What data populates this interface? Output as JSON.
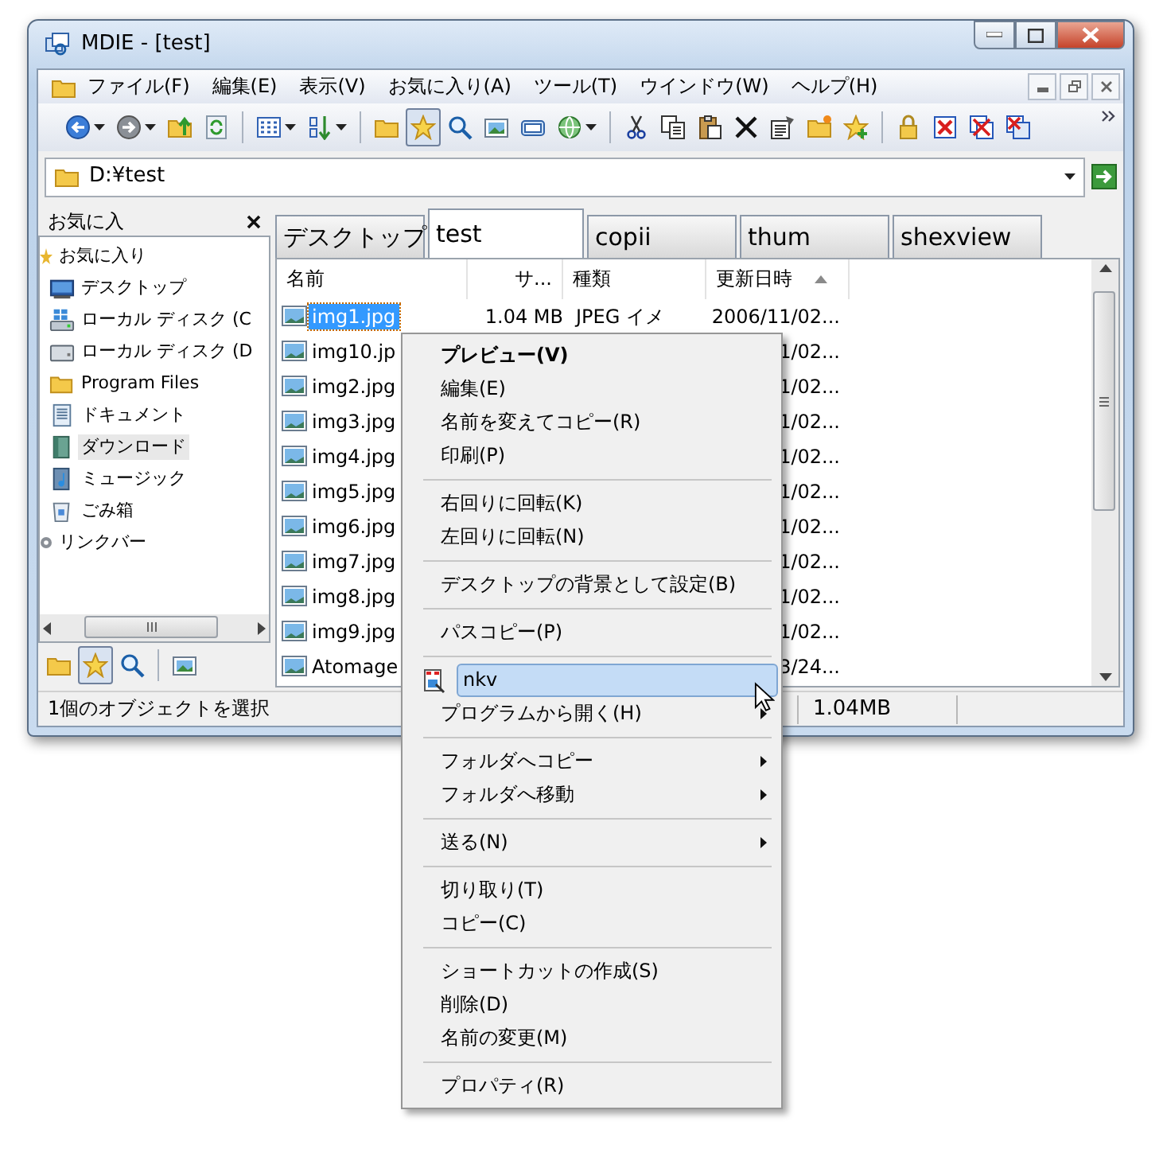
{
  "window": {
    "title": "MDIE - [test]"
  },
  "menu_bar": [
    "ファイル(F)",
    "編集(E)",
    "表示(V)",
    "お気に入り(A)",
    "ツール(T)",
    "ウインドウ(W)",
    "ヘルプ(H)"
  ],
  "toolbar": [
    {
      "pressed": false
    },
    {
      "pressed": false
    },
    {
      "pressed": false
    },
    {
      "pressed": false
    },
    {
      "pressed": false
    },
    {
      "pressed": false
    },
    {
      "pressed": false
    },
    {
      "pressed": true
    },
    {
      "pressed": false
    },
    {
      "pressed": false
    },
    {
      "pressed": false
    },
    {
      "pressed": false
    },
    {
      "pressed": false
    },
    {
      "pressed": false
    },
    {
      "pressed": false
    },
    {
      "pressed": false
    },
    {
      "pressed": false
    },
    {
      "pressed": false
    },
    {
      "pressed": false
    },
    {
      "pressed": false
    },
    {
      "pressed": false
    },
    {
      "pressed": false
    },
    {
      "pressed": false
    }
  ],
  "address": {
    "value": "D:¥test"
  },
  "favorites_pane": {
    "title": "お気に入",
    "tree": [
      {
        "label": "お気に入り",
        "selected": false,
        "children": [
          {
            "label": "デスクトップ",
            "selected": false
          },
          {
            "label": "ローカル ディスク (C",
            "selected": false
          },
          {
            "label": "ローカル ディスク (D",
            "selected": false
          },
          {
            "label": "Program Files",
            "selected": false
          },
          {
            "label": "ドキュメント",
            "selected": false
          },
          {
            "label": "ダウンロード",
            "selected": true
          },
          {
            "label": "ミュージック",
            "selected": false
          },
          {
            "label": "ごみ箱",
            "selected": false
          }
        ]
      },
      {
        "label": "リンクバー",
        "selected": false
      }
    ],
    "toolbar": [
      {
        "pressed": false
      },
      {
        "pressed": true
      },
      {
        "pressed": false
      },
      {
        "pressed": false
      }
    ]
  },
  "tabs": [
    {
      "label": "デスクトップ",
      "selected": false
    },
    {
      "label": "test",
      "selected": true
    },
    {
      "label": "copii",
      "selected": false
    },
    {
      "label": "thum",
      "selected": false
    },
    {
      "label": "shexview",
      "selected": false
    }
  ],
  "file_list": {
    "columns": [
      {
        "label": "名前",
        "sorted": false
      },
      {
        "label": "サ...",
        "sorted": false
      },
      {
        "label": "種類",
        "sorted": false
      },
      {
        "label": "更新日時",
        "sorted": true
      }
    ],
    "rows": [
      {
        "name": "img1.jpg",
        "selected": true,
        "size": "1.04 MB",
        "type": "JPEG イメ",
        "modified": "2006/11/02..."
      },
      {
        "name": "img10.jp",
        "selected": false,
        "modified": "1/02..."
      },
      {
        "name": "img2.jpg",
        "selected": false,
        "modified": "1/02..."
      },
      {
        "name": "img3.jpg",
        "selected": false,
        "modified": "1/02..."
      },
      {
        "name": "img4.jpg",
        "selected": false,
        "modified": "1/02..."
      },
      {
        "name": "img5.jpg",
        "selected": false,
        "modified": "1/02..."
      },
      {
        "name": "img6.jpg",
        "selected": false,
        "modified": "1/02..."
      },
      {
        "name": "img7.jpg",
        "selected": false,
        "modified": "1/02..."
      },
      {
        "name": "img8.jpg",
        "selected": false,
        "modified": "1/02..."
      },
      {
        "name": "img9.jpg",
        "selected": false,
        "modified": "1/02..."
      },
      {
        "name": "Atomage",
        "selected": false,
        "modified": "3/24..."
      }
    ]
  },
  "status_bar": [
    "1個のオブジェクトを選択",
    "1.04MB"
  ],
  "context_menu": [
    {
      "kind": "item",
      "label": "プレビュー(V)",
      "bold": true,
      "submenu": false,
      "selected": false
    },
    {
      "kind": "item",
      "label": "編集(E)",
      "bold": false,
      "submenu": false,
      "selected": false
    },
    {
      "kind": "item",
      "label": "名前を変えてコピー(R)",
      "bold": false,
      "submenu": false,
      "selected": false
    },
    {
      "kind": "item",
      "label": "印刷(P)",
      "bold": false,
      "submenu": false,
      "selected": false
    },
    {
      "kind": "separator"
    },
    {
      "kind": "item",
      "label": "右回りに回転(K)",
      "bold": false,
      "submenu": false,
      "selected": false
    },
    {
      "kind": "item",
      "label": "左回りに回転(N)",
      "bold": false,
      "submenu": false,
      "selected": false
    },
    {
      "kind": "separator"
    },
    {
      "kind": "item",
      "label": "デスクトップの背景として設定(B)",
      "bold": false,
      "submenu": false,
      "selected": false
    },
    {
      "kind": "separator"
    },
    {
      "kind": "item",
      "label": "パスコピー(P)",
      "bold": false,
      "submenu": false,
      "selected": false
    },
    {
      "kind": "separator"
    },
    {
      "kind": "app",
      "label": "nkv",
      "bold": false,
      "submenu": false,
      "selected": true
    },
    {
      "kind": "item",
      "label": "プログラムから開く(H)",
      "bold": false,
      "submenu": true,
      "selected": false
    },
    {
      "kind": "separator"
    },
    {
      "kind": "item",
      "label": "フォルダへコピー",
      "bold": false,
      "submenu": true,
      "selected": false
    },
    {
      "kind": "item",
      "label": "フォルダへ移動",
      "bold": false,
      "submenu": true,
      "selected": false
    },
    {
      "kind": "separator"
    },
    {
      "kind": "item",
      "label": "送る(N)",
      "bold": false,
      "submenu": true,
      "selected": false
    },
    {
      "kind": "separator"
    },
    {
      "kind": "item",
      "label": "切り取り(T)",
      "bold": false,
      "submenu": false,
      "selected": false
    },
    {
      "kind": "item",
      "label": "コピー(C)",
      "bold": false,
      "submenu": false,
      "selected": false
    },
    {
      "kind": "separator"
    },
    {
      "kind": "item",
      "label": "ショートカットの作成(S)",
      "bold": false,
      "submenu": false,
      "selected": false
    },
    {
      "kind": "item",
      "label": "削除(D)",
      "bold": false,
      "submenu": false,
      "selected": false
    },
    {
      "kind": "item",
      "label": "名前の変更(M)",
      "bold": false,
      "submenu": false,
      "selected": false
    },
    {
      "kind": "separator"
    },
    {
      "kind": "item",
      "label": "プロパティ(R)",
      "bold": false,
      "submenu": false,
      "selected": false
    }
  ]
}
